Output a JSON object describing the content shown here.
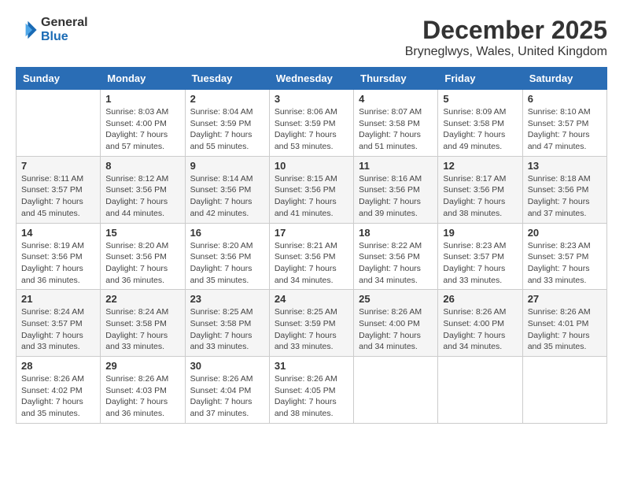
{
  "header": {
    "logo_general": "General",
    "logo_blue": "Blue",
    "month_title": "December 2025",
    "location": "Bryneglwys, Wales, United Kingdom"
  },
  "days_of_week": [
    "Sunday",
    "Monday",
    "Tuesday",
    "Wednesday",
    "Thursday",
    "Friday",
    "Saturday"
  ],
  "weeks": [
    [
      {
        "day": "",
        "info": ""
      },
      {
        "day": "1",
        "info": "Sunrise: 8:03 AM\nSunset: 4:00 PM\nDaylight: 7 hours\nand 57 minutes."
      },
      {
        "day": "2",
        "info": "Sunrise: 8:04 AM\nSunset: 3:59 PM\nDaylight: 7 hours\nand 55 minutes."
      },
      {
        "day": "3",
        "info": "Sunrise: 8:06 AM\nSunset: 3:59 PM\nDaylight: 7 hours\nand 53 minutes."
      },
      {
        "day": "4",
        "info": "Sunrise: 8:07 AM\nSunset: 3:58 PM\nDaylight: 7 hours\nand 51 minutes."
      },
      {
        "day": "5",
        "info": "Sunrise: 8:09 AM\nSunset: 3:58 PM\nDaylight: 7 hours\nand 49 minutes."
      },
      {
        "day": "6",
        "info": "Sunrise: 8:10 AM\nSunset: 3:57 PM\nDaylight: 7 hours\nand 47 minutes."
      }
    ],
    [
      {
        "day": "7",
        "info": "Sunrise: 8:11 AM\nSunset: 3:57 PM\nDaylight: 7 hours\nand 45 minutes."
      },
      {
        "day": "8",
        "info": "Sunrise: 8:12 AM\nSunset: 3:56 PM\nDaylight: 7 hours\nand 44 minutes."
      },
      {
        "day": "9",
        "info": "Sunrise: 8:14 AM\nSunset: 3:56 PM\nDaylight: 7 hours\nand 42 minutes."
      },
      {
        "day": "10",
        "info": "Sunrise: 8:15 AM\nSunset: 3:56 PM\nDaylight: 7 hours\nand 41 minutes."
      },
      {
        "day": "11",
        "info": "Sunrise: 8:16 AM\nSunset: 3:56 PM\nDaylight: 7 hours\nand 39 minutes."
      },
      {
        "day": "12",
        "info": "Sunrise: 8:17 AM\nSunset: 3:56 PM\nDaylight: 7 hours\nand 38 minutes."
      },
      {
        "day": "13",
        "info": "Sunrise: 8:18 AM\nSunset: 3:56 PM\nDaylight: 7 hours\nand 37 minutes."
      }
    ],
    [
      {
        "day": "14",
        "info": "Sunrise: 8:19 AM\nSunset: 3:56 PM\nDaylight: 7 hours\nand 36 minutes."
      },
      {
        "day": "15",
        "info": "Sunrise: 8:20 AM\nSunset: 3:56 PM\nDaylight: 7 hours\nand 36 minutes."
      },
      {
        "day": "16",
        "info": "Sunrise: 8:20 AM\nSunset: 3:56 PM\nDaylight: 7 hours\nand 35 minutes."
      },
      {
        "day": "17",
        "info": "Sunrise: 8:21 AM\nSunset: 3:56 PM\nDaylight: 7 hours\nand 34 minutes."
      },
      {
        "day": "18",
        "info": "Sunrise: 8:22 AM\nSunset: 3:56 PM\nDaylight: 7 hours\nand 34 minutes."
      },
      {
        "day": "19",
        "info": "Sunrise: 8:23 AM\nSunset: 3:57 PM\nDaylight: 7 hours\nand 33 minutes."
      },
      {
        "day": "20",
        "info": "Sunrise: 8:23 AM\nSunset: 3:57 PM\nDaylight: 7 hours\nand 33 minutes."
      }
    ],
    [
      {
        "day": "21",
        "info": "Sunrise: 8:24 AM\nSunset: 3:57 PM\nDaylight: 7 hours\nand 33 minutes."
      },
      {
        "day": "22",
        "info": "Sunrise: 8:24 AM\nSunset: 3:58 PM\nDaylight: 7 hours\nand 33 minutes."
      },
      {
        "day": "23",
        "info": "Sunrise: 8:25 AM\nSunset: 3:58 PM\nDaylight: 7 hours\nand 33 minutes."
      },
      {
        "day": "24",
        "info": "Sunrise: 8:25 AM\nSunset: 3:59 PM\nDaylight: 7 hours\nand 33 minutes."
      },
      {
        "day": "25",
        "info": "Sunrise: 8:26 AM\nSunset: 4:00 PM\nDaylight: 7 hours\nand 34 minutes."
      },
      {
        "day": "26",
        "info": "Sunrise: 8:26 AM\nSunset: 4:00 PM\nDaylight: 7 hours\nand 34 minutes."
      },
      {
        "day": "27",
        "info": "Sunrise: 8:26 AM\nSunset: 4:01 PM\nDaylight: 7 hours\nand 35 minutes."
      }
    ],
    [
      {
        "day": "28",
        "info": "Sunrise: 8:26 AM\nSunset: 4:02 PM\nDaylight: 7 hours\nand 35 minutes."
      },
      {
        "day": "29",
        "info": "Sunrise: 8:26 AM\nSunset: 4:03 PM\nDaylight: 7 hours\nand 36 minutes."
      },
      {
        "day": "30",
        "info": "Sunrise: 8:26 AM\nSunset: 4:04 PM\nDaylight: 7 hours\nand 37 minutes."
      },
      {
        "day": "31",
        "info": "Sunrise: 8:26 AM\nSunset: 4:05 PM\nDaylight: 7 hours\nand 38 minutes."
      },
      {
        "day": "",
        "info": ""
      },
      {
        "day": "",
        "info": ""
      },
      {
        "day": "",
        "info": ""
      }
    ]
  ]
}
